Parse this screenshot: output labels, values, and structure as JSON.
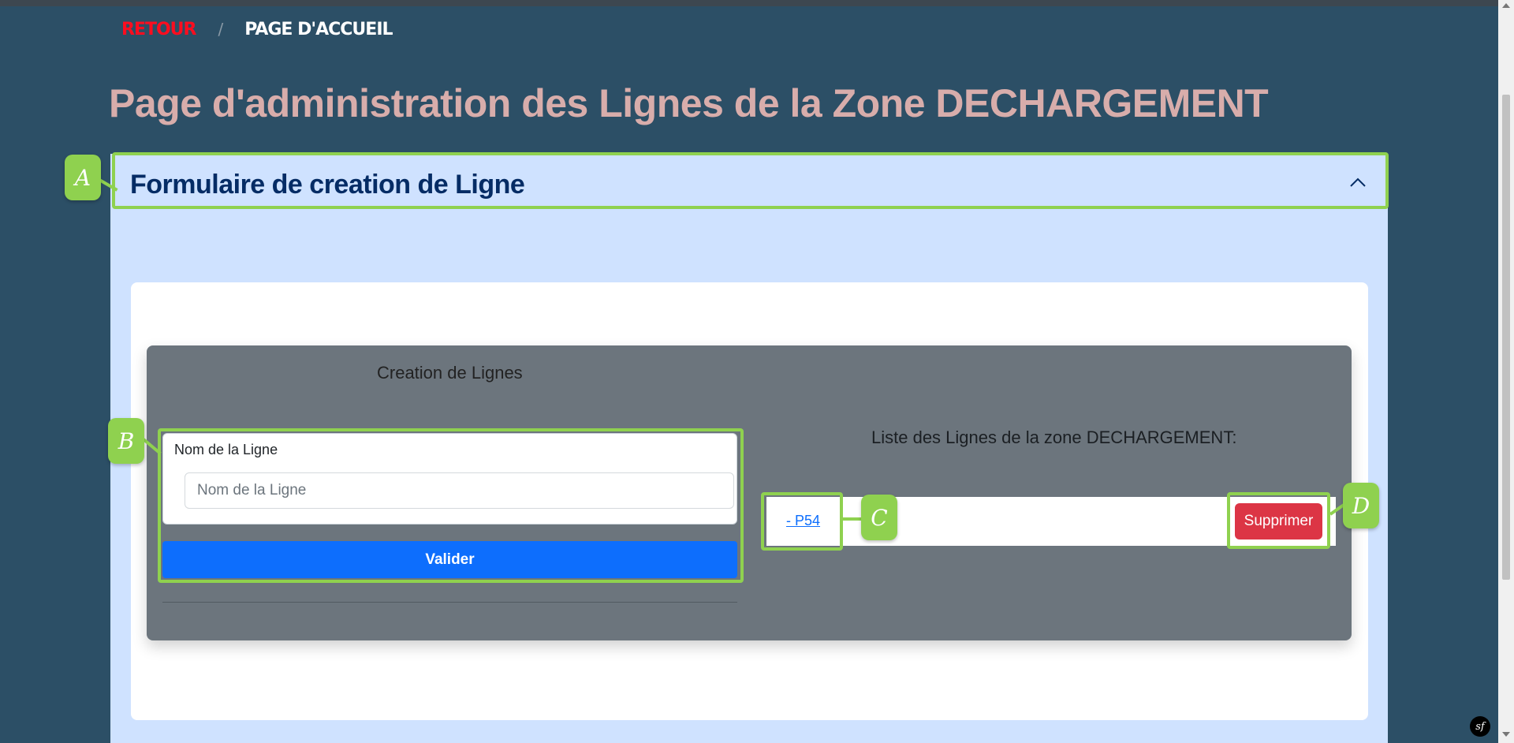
{
  "breadcrumb": {
    "back_label": "RETOUR",
    "separator": "/",
    "home_label": "PAGE D'ACCUEIL"
  },
  "page_title": "Page d'administration des Lignes de la Zone DECHARGEMENT",
  "accordion": {
    "title": "Formulaire de creation de Ligne",
    "chevron_icon": "chevron-up-icon",
    "expanded": true
  },
  "creation": {
    "title": "Creation de Lignes",
    "field_label": "Nom de la Ligne",
    "field_placeholder": "Nom de la Ligne",
    "field_value": "",
    "submit_label": "Valider"
  },
  "list": {
    "title": "Liste des Lignes de la zone DECHARGEMENT:",
    "items": [
      {
        "label": "- P54",
        "delete_label": "Supprimer"
      }
    ]
  },
  "annotations": [
    "A",
    "B",
    "C",
    "D"
  ],
  "debug_toolbar": {
    "logo_text": "sf"
  },
  "colors": {
    "background": "#2c4f66",
    "title": "#d8adab",
    "panel": "#cfe2ff",
    "panel_title": "#052c65",
    "gray_card": "#6c757d",
    "primary": "#0d6efd",
    "danger": "#dc3545",
    "back_link": "#ff0d1f",
    "annotation": "#8fd14f"
  }
}
